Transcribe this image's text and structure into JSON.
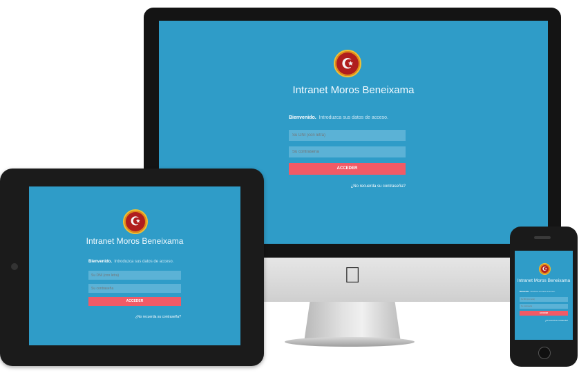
{
  "login": {
    "title": "Intranet Moros Beneixama",
    "welcome_bold": "Bienvenido.",
    "welcome_text": "Introduzca sus datos de acceso.",
    "dni_placeholder": "Su DNI (con letra)",
    "password_placeholder": "Su contraseña",
    "submit_label": "ACCEDER",
    "forgot_label": "¿No recuerda su contraseña?",
    "logo_glyph": "☪"
  },
  "colors": {
    "screen_bg": "#2f9cc8",
    "field_bg": "#5bb2d6",
    "button_bg": "#f15a66",
    "logo_red": "#b01e1e",
    "logo_gold": "#f2c132"
  },
  "devices": {
    "desktop_logo_icon": "apple-logo-icon"
  }
}
